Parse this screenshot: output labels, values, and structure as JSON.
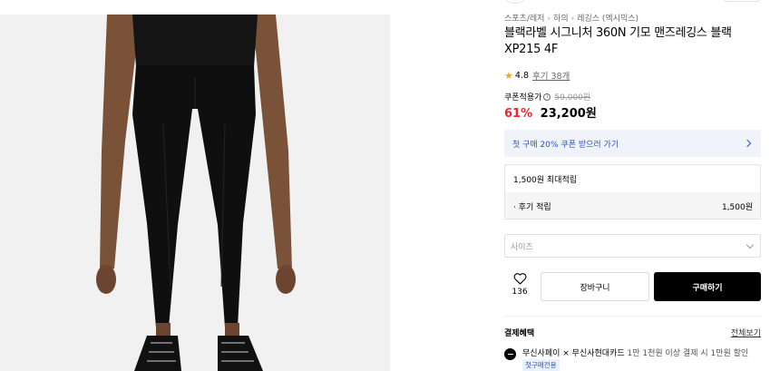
{
  "breadcrumb": [
    "스포츠/레저",
    "하의",
    "레깅스 (엑시믹스)"
  ],
  "product": {
    "title": "블랙라벨 시그니처 360N 기모 맨즈레깅스 블랙 XP215 4F",
    "rating": "4.8",
    "review_text": "후기 38개"
  },
  "price": {
    "coupon_label": "쿠폰적용가",
    "info_icon": "ⓘ",
    "original": "59,000원",
    "discount": "61%",
    "sale": "23,200원"
  },
  "coupon_banner": {
    "text": "첫 구매 20% 쿠폰 받으러 가기"
  },
  "points": {
    "title": "1,500원 최대적립",
    "row_label": "· 후기 적립",
    "row_value": "1,500원"
  },
  "size_select": {
    "placeholder": "사이즈"
  },
  "actions": {
    "like_count": "136",
    "cart_label": "장바구니",
    "buy_label": "구매하기"
  },
  "benefits": {
    "title": "결제혜택",
    "view_all": "전체보기",
    "items": [
      {
        "card": "무신사페이 × 무신사현대카드",
        "desc": "1만 1천원 이상 결제 시 1만원 할인",
        "badge": "첫구매전용"
      }
    ]
  },
  "colors": {
    "discount": "#f1282b",
    "accent_blue": "#2d52c9",
    "buy_button_bg": "#000000",
    "star": "#f5a623"
  },
  "icons": [
    "star-icon",
    "info-icon",
    "chevron-right-icon",
    "chevron-down-icon",
    "heart-icon",
    "musinsa-pay-icon"
  ]
}
